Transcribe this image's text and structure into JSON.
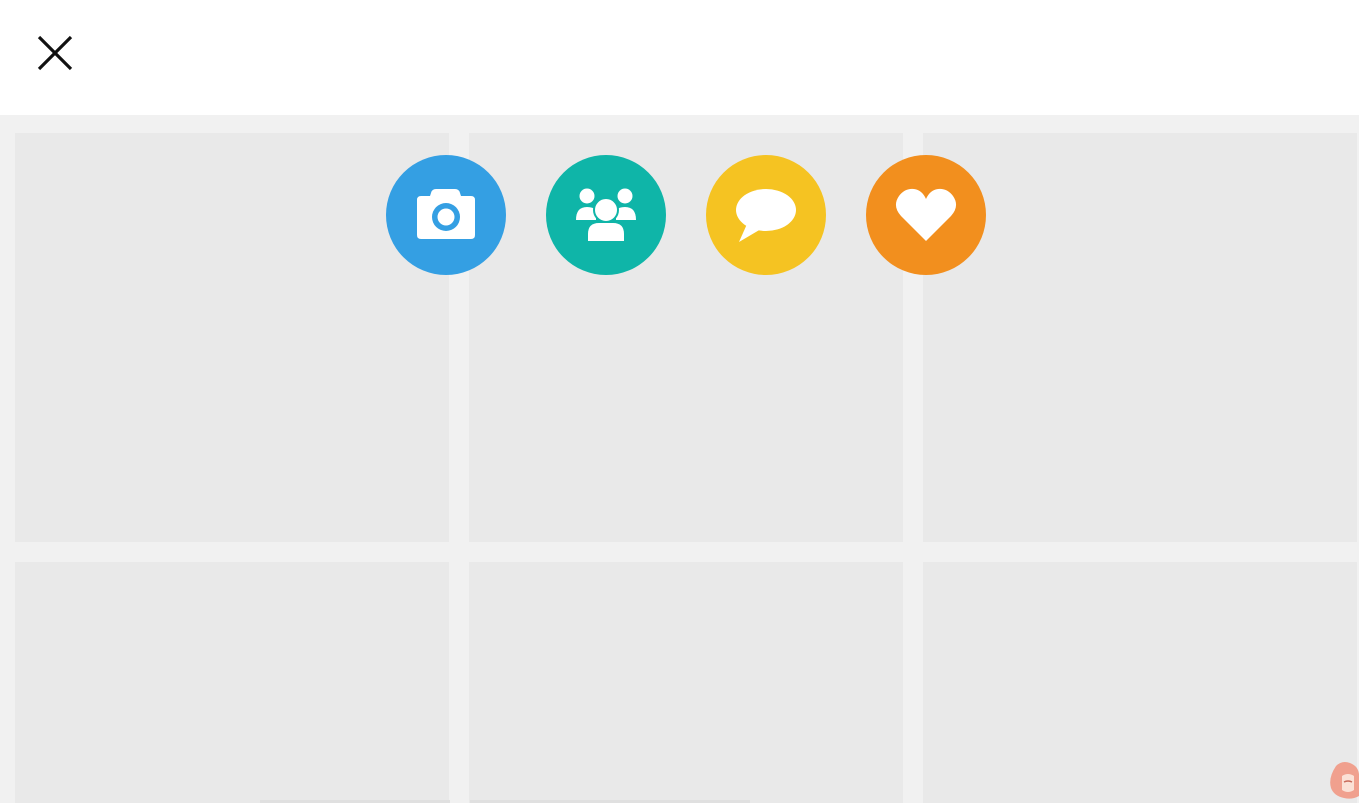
{
  "header": {
    "close_icon": "close-icon"
  },
  "grid": {
    "tile_count": 6,
    "tile_color": "#e9e9e9",
    "background_color": "#f1f1f1"
  },
  "share_buttons": [
    {
      "name": "camera",
      "icon": "camera-icon",
      "color": "#349fe3"
    },
    {
      "name": "group",
      "icon": "users-icon",
      "color": "#0fb5a8"
    },
    {
      "name": "chat",
      "icon": "speech-bubble-icon",
      "color": "#f5c322"
    },
    {
      "name": "heart",
      "icon": "heart-icon",
      "color": "#f28f1e"
    }
  ],
  "mascot": {
    "icon": "mascot-icon"
  }
}
